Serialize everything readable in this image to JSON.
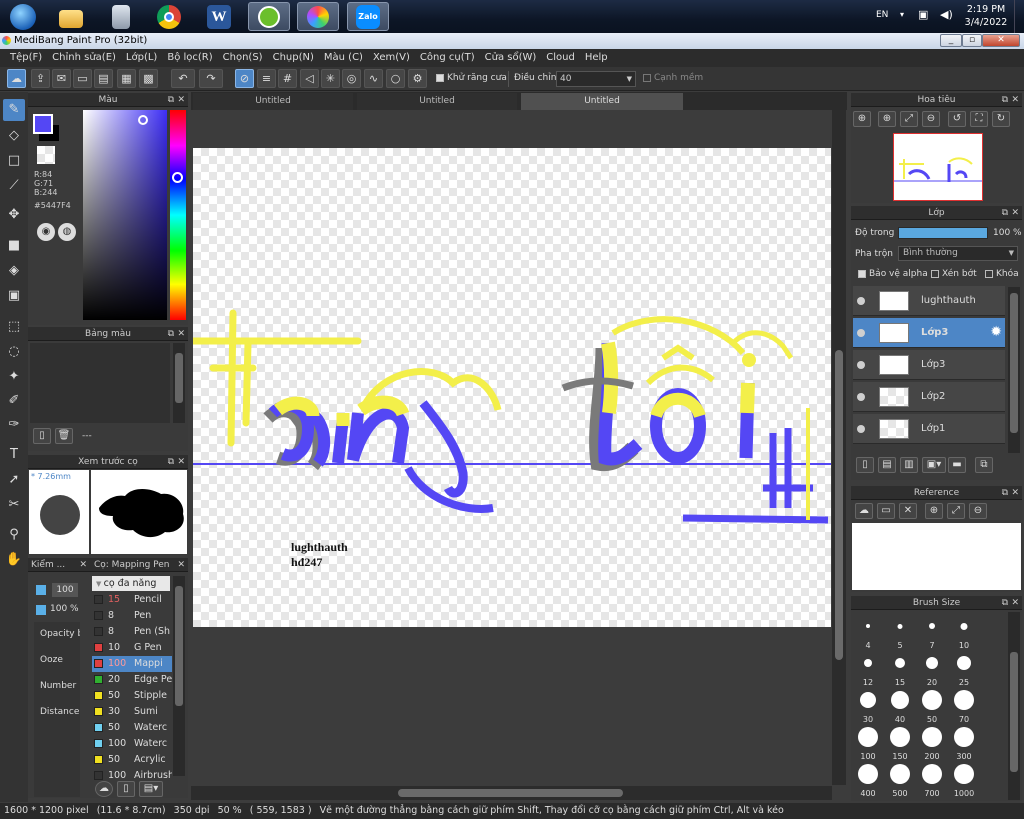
{
  "taskbar": {
    "lang": "EN",
    "time": "2:19 PM",
    "date": "3/4/2022",
    "apps": [
      "start-icon",
      "folder-icon",
      "calculator-icon",
      "chrome-icon",
      "word-icon",
      "app-green-icon",
      "medibang-icon",
      "zalo-icon"
    ],
    "zalo_label": "Zalo",
    "word_label": "W"
  },
  "window": {
    "title": "MediBang Paint Pro (32bit)"
  },
  "menu": [
    "Tệp(F)",
    "Chỉnh sửa(E)",
    "Lớp(L)",
    "Bộ lọc(R)",
    "Chọn(S)",
    "Chụp(N)",
    "Màu (C)",
    "Xem(V)",
    "Công cụ(T)",
    "Cửa sổ(W)",
    "Cloud",
    "Help"
  ],
  "toolbar": {
    "antialias_label": "Khử răng cưa",
    "adjust_label": "Điều chỉnh",
    "adjust_value": "40",
    "smooth_label": "Cạnh mềm"
  },
  "tabs": [
    "Untitled",
    "Untitled",
    "Untitled"
  ],
  "color_panel": {
    "title": "Màu",
    "r": "R:84",
    "g": "G:71",
    "b": "B:244",
    "hex": "#5447F4",
    "fg_color": "#5447F4"
  },
  "palette_panel": {
    "title": "Bảng màu",
    "swatches": [
      "#ff5a7a",
      "#5ad0e0",
      "#b0a8ff",
      "#e880e8",
      "#8080ff",
      "#4a4a4a",
      "#e04040",
      "#408040",
      "#30a090",
      "#ff88ee"
    ],
    "dash": "---"
  },
  "preview_panel": {
    "title": "Xem trước cọ",
    "size": "* 7.26mm"
  },
  "brush_settings": {
    "title": "Kiểm ...",
    "size_value": "100",
    "opacity_value": "100 %",
    "labels": [
      "Opacity b",
      "Ooze",
      "Number",
      "Distance"
    ]
  },
  "brush_list": {
    "title": "Cọ: Mapping Pen",
    "category": "cọ đa năng",
    "items": [
      {
        "size": "15",
        "name": "Pencil",
        "color": "#333333"
      },
      {
        "size": "8",
        "name": "Pen",
        "color": "#333333"
      },
      {
        "size": "8",
        "name": "Pen (Sh",
        "color": "#333333"
      },
      {
        "size": "10",
        "name": "G Pen",
        "color": "#e04040"
      },
      {
        "size": "100",
        "name": "Mappi",
        "color": "#e04040"
      },
      {
        "size": "20",
        "name": "Edge Pe",
        "color": "#30b030"
      },
      {
        "size": "50",
        "name": "Stipple",
        "color": "#f0e020"
      },
      {
        "size": "30",
        "name": "Sumi",
        "color": "#f0e020"
      },
      {
        "size": "50",
        "name": "Waterc",
        "color": "#70d0f0"
      },
      {
        "size": "100",
        "name": "Waterc",
        "color": "#70d0f0"
      },
      {
        "size": "50",
        "name": "Acrylic",
        "color": "#f0e020"
      },
      {
        "size": "100",
        "name": "Airbrush",
        "color": "#333333"
      }
    ]
  },
  "canvas": {
    "text_line1": "lughthauth",
    "text_line2": "hđ247"
  },
  "navigator": {
    "title": "Hoa tiêu"
  },
  "layer_panel": {
    "title": "Lớp",
    "opacity_label": "Độ trong",
    "opacity_value": "100 %",
    "blend_label": "Pha trộn",
    "blend_value": "Bình thường",
    "protect_alpha": "Bảo vệ alpha",
    "clip": "Xén bớt",
    "lock": "Khóa",
    "layers": [
      "lughthauth",
      "Lớp3",
      "Lớp3",
      "Lớp2",
      "Lớp1"
    ]
  },
  "reference_panel": {
    "title": "Reference"
  },
  "brush_size_panel": {
    "title": "Brush Size",
    "sizes": [
      "4",
      "5",
      "7",
      "10",
      "12",
      "15",
      "20",
      "25",
      "30",
      "40",
      "50",
      "70",
      "100",
      "150",
      "200",
      "300",
      "400",
      "500",
      "700",
      "1000"
    ]
  },
  "status": {
    "dimensions": "1600 * 1200 pixel",
    "physical": "(11.6 * 8.7cm)",
    "dpi": "350 dpi",
    "zoom": "50 %",
    "coords": "( 559, 1583 )",
    "hint": "Vẽ một đường thẳng bằng cách giữ phím Shift, Thay đổi cỡ cọ bằng cách giữ phím Ctrl, Alt và kéo"
  }
}
